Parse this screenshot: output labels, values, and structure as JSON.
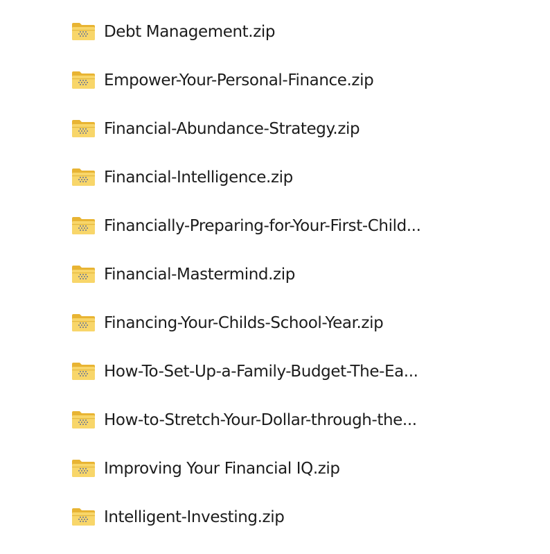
{
  "icon": "zip-folder-icon",
  "colors": {
    "folder_back": "#e8b433",
    "folder_front": "#f8d66a",
    "zipper": "#8a8a8a",
    "text": "#1c1c1c"
  },
  "files": [
    {
      "name": "Debt Management.zip"
    },
    {
      "name": "Empower-Your-Personal-Finance.zip"
    },
    {
      "name": "Financial-Abundance-Strategy.zip"
    },
    {
      "name": "Financial-Intelligence.zip"
    },
    {
      "name": "Financially-Preparing-for-Your-First-Child..."
    },
    {
      "name": "Financial-Mastermind.zip"
    },
    {
      "name": "Financing-Your-Childs-School-Year.zip"
    },
    {
      "name": "How-To-Set-Up-a-Family-Budget-The-Ea..."
    },
    {
      "name": "How-to-Stretch-Your-Dollar-through-the..."
    },
    {
      "name": "Improving Your Financial IQ.zip"
    },
    {
      "name": "Intelligent-Investing.zip"
    }
  ]
}
